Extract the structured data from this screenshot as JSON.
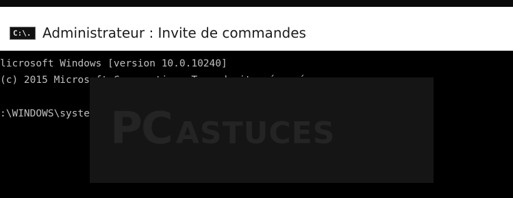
{
  "window": {
    "title": "Administrateur : Invite de commandes",
    "icon_label": "C:\\."
  },
  "console": {
    "lines": [
      "licrosoft Windows [version 10.0.10240]",
      "(c) 2015 Microsoft Corporation. Tous droits réservés.",
      ":\\WINDOWS\\system32>netsh wlan show profiles"
    ]
  },
  "watermark": {
    "big": "PC",
    "small": "ASTUCES"
  },
  "icons": {
    "title_icon": "cmd-console-icon",
    "cursor": "text-cursor"
  },
  "colors": {
    "console_bg": "#000000",
    "console_text": "#c0c0c0",
    "titlebar_bg": "#ffffff"
  }
}
